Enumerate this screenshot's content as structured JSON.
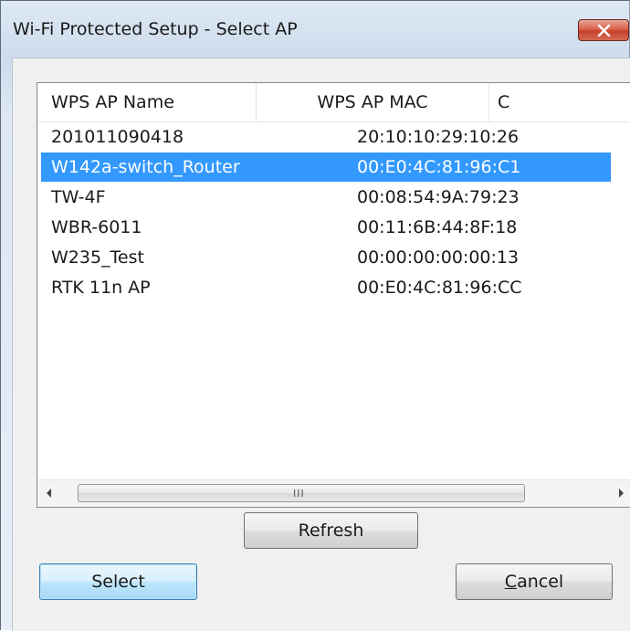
{
  "window": {
    "title": "Wi-Fi Protected Setup - Select AP",
    "close_icon": "close-x-icon"
  },
  "list": {
    "columns": [
      "WPS AP Name",
      "WPS AP MAC",
      "C"
    ],
    "rows": [
      {
        "name": "201011090418",
        "mac": "20:10:10:29:10:26",
        "selected": false
      },
      {
        "name": "W142a-switch_Router",
        "mac": "00:E0:4C:81:96:C1",
        "selected": true
      },
      {
        "name": "TW-4F",
        "mac": "00:08:54:9A:79:23",
        "selected": false
      },
      {
        "name": "WBR-6011",
        "mac": "00:11:6B:44:8F:18",
        "selected": false
      },
      {
        "name": "W235_Test",
        "mac": "00:00:00:00:00:13",
        "selected": false
      },
      {
        "name": "RTK 11n AP",
        "mac": "00:E0:4C:81:96:CC",
        "selected": false
      }
    ],
    "scrollbar": {
      "grip": "III"
    }
  },
  "buttons": {
    "refresh": "Refresh",
    "select": "Select",
    "cancel_prefix": "C",
    "cancel_rest": "ancel"
  },
  "colors": {
    "selection": "#3399ff",
    "close_button": "#c7402b"
  }
}
